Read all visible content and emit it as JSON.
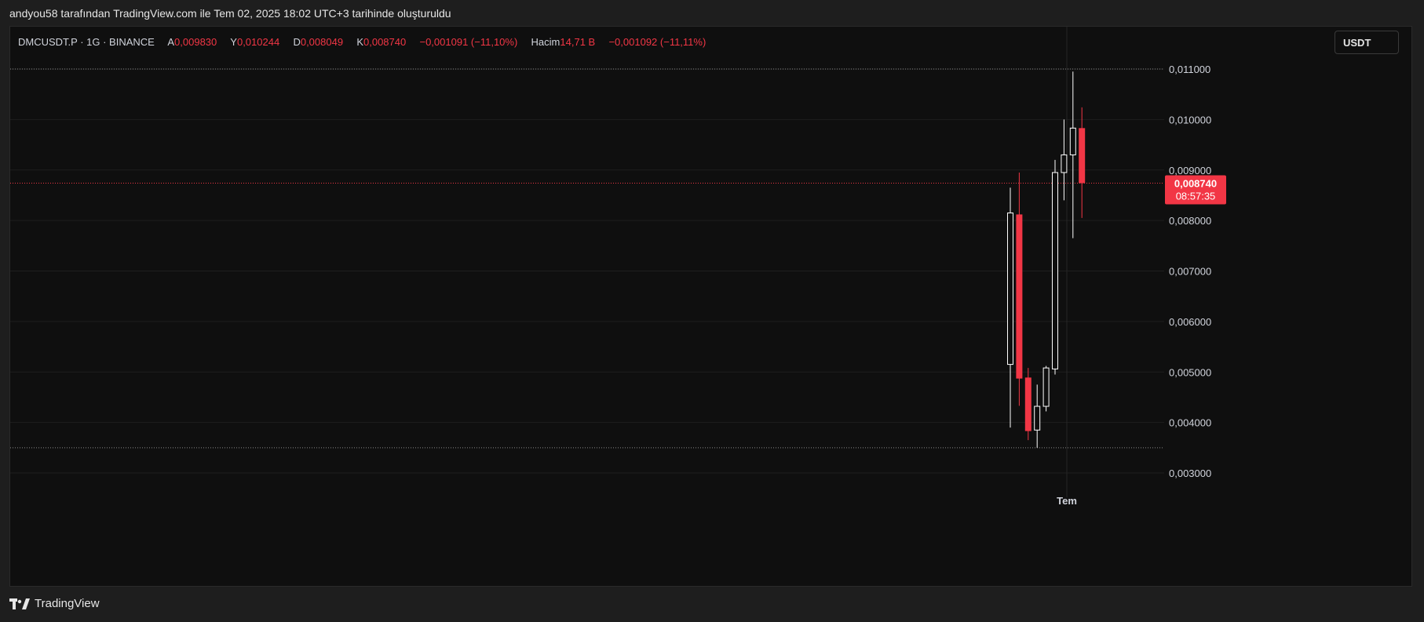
{
  "caption": "andyou58 tarafından TradingView.com ile Tem 02, 2025 18:02 UTC+3 tarihinde oluşturuldu",
  "legend": {
    "symbol": "DMCUSDT.P · 1G · BINANCE",
    "open_label": "A",
    "open": "0,009830",
    "high_label": "Y",
    "high": "0,010244",
    "low_label": "D",
    "low": "0,008049",
    "close_label": "K",
    "close": "0,008740",
    "change": "−0,001091 (−11,10%)",
    "volume_label": "Hacim",
    "volume": "14,71 B",
    "volume_change": "−0,001092 (−11,11%)"
  },
  "currency_button": "USDT",
  "footer_brand": "TradingView",
  "colors": {
    "up": "#ffffff",
    "down": "#f23645",
    "grid": "#1f1f1f",
    "text": "#d1d4dc",
    "price_line": "#f23645"
  },
  "chart_data": {
    "type": "candlestick",
    "y_ticks": [
      "0,011000",
      "0,010000",
      "0,009000",
      "0,008000",
      "0,007000",
      "0,006000",
      "0,005000",
      "0,004000",
      "0,003000"
    ],
    "y_tick_values": [
      0.011,
      0.01,
      0.009,
      0.008,
      0.007,
      0.006,
      0.005,
      0.004,
      0.003
    ],
    "x_label": "Tem",
    "candles": [
      {
        "o": 0.00515,
        "h": 0.00865,
        "l": 0.0039,
        "c": 0.00815
      },
      {
        "o": 0.00812,
        "h": 0.00895,
        "l": 0.00433,
        "c": 0.00487
      },
      {
        "o": 0.00489,
        "h": 0.00508,
        "l": 0.00365,
        "c": 0.00383
      },
      {
        "o": 0.00385,
        "h": 0.00475,
        "l": 0.0035,
        "c": 0.00432
      },
      {
        "o": 0.00432,
        "h": 0.00512,
        "l": 0.00422,
        "c": 0.00508
      },
      {
        "o": 0.00506,
        "h": 0.0092,
        "l": 0.00495,
        "c": 0.00895
      },
      {
        "o": 0.00895,
        "h": 0.01,
        "l": 0.0084,
        "c": 0.0093
      },
      {
        "o": 0.0093,
        "h": 0.01095,
        "l": 0.00765,
        "c": 0.00983
      },
      {
        "o": 0.00983,
        "h": 0.01024,
        "l": 0.00805,
        "c": 0.00874
      }
    ],
    "last_price": "0,008740",
    "last_price_value": 0.00874,
    "countdown": "08:57:35",
    "high_marker_value": 0.011,
    "low_marker_value": 0.0035
  }
}
